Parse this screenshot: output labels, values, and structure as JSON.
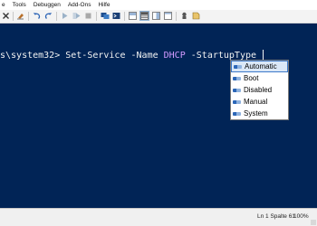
{
  "menu": {
    "items": [
      {
        "label": "e"
      },
      {
        "label": "Tools"
      },
      {
        "label": "Debuggen"
      },
      {
        "label": "Add-Ons"
      },
      {
        "label": "Hilfe"
      }
    ]
  },
  "toolbar": {
    "buttons": [
      {
        "icon": "delete-icon"
      },
      {
        "icon": "clear-icon"
      },
      {
        "icon": "undo-icon"
      },
      {
        "icon": "redo-icon"
      },
      {
        "icon": "run-icon"
      },
      {
        "icon": "run-selection-icon"
      },
      {
        "icon": "stop-icon"
      },
      {
        "icon": "remote-powershell-icon"
      },
      {
        "icon": "console-icon"
      },
      {
        "icon": "show-script-pane-top-icon"
      },
      {
        "icon": "show-script-pane-right-icon"
      },
      {
        "icon": "show-script-pane-maximized-icon"
      },
      {
        "icon": "commands-addon-icon"
      },
      {
        "icon": "show-commands-icon"
      }
    ]
  },
  "console": {
    "prompt": "s\\system32> ",
    "command": "Set-Service",
    "param_name": " -Name ",
    "param_value": "DHCP",
    "param_startup": " -StartupType ",
    "colors": {
      "background": "#012456",
      "text": "#f2f2f2",
      "value": "#d29aff"
    }
  },
  "intellisense": {
    "items": [
      {
        "label": "Automatic",
        "selected": true
      },
      {
        "label": "Boot",
        "selected": false
      },
      {
        "label": "Disabled",
        "selected": false
      },
      {
        "label": "Manual",
        "selected": false
      },
      {
        "label": "System",
        "selected": false
      }
    ],
    "icon": "enum-value-icon"
  },
  "status": {
    "position": "Ln 1  Spalte 61",
    "zoom": "100%"
  }
}
